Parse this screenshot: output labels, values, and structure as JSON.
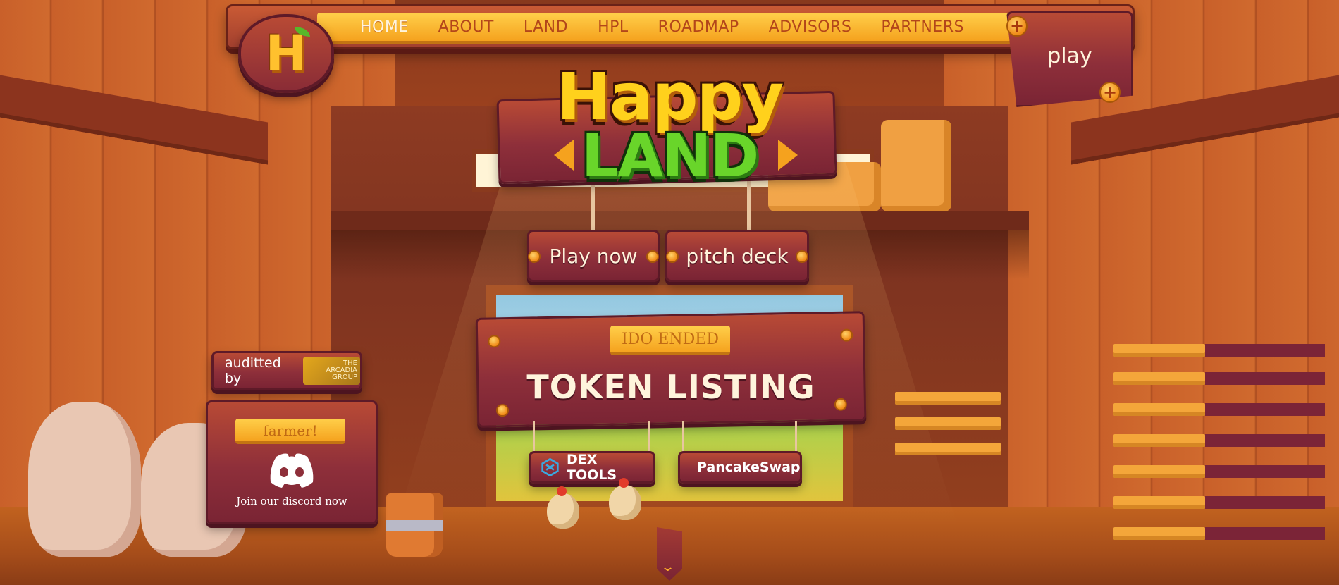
{
  "nav": {
    "items": [
      {
        "label": "HOME",
        "active": true
      },
      {
        "label": "ABOUT",
        "active": false
      },
      {
        "label": "LAND",
        "active": false
      },
      {
        "label": "HPL",
        "active": false
      },
      {
        "label": "ROADMAP",
        "active": false
      },
      {
        "label": "ADVISORS",
        "active": false
      },
      {
        "label": "PARTNERS",
        "active": false
      }
    ],
    "logo_letter": "H",
    "play_label": "play",
    "plus_icon": "+"
  },
  "hero": {
    "title_top": "Happy",
    "title_bottom": "LAND",
    "play_now_label": "Play now",
    "pitch_deck_label": "pitch deck"
  },
  "token": {
    "status_tag": "IDO ENDED",
    "headline": "TOKEN LISTING",
    "dextools_label": "DEX TOOLS",
    "pancakeswap_label": "PancakeSwap"
  },
  "audit": {
    "label": "auditted by",
    "auditor_logo_text": [
      "THE",
      "ARCADIA",
      "GROUP"
    ]
  },
  "discord": {
    "tag": "farmer!",
    "cta": "Join our discord now"
  },
  "scroll": {
    "chevron": "⌄"
  },
  "colors": {
    "accent_yellow": "#ffcf4a",
    "wood_dark": "#8e2f3a",
    "logo_green": "#69d52a",
    "logo_yellow": "#ffd11c",
    "text_light": "#fff4dc",
    "nav_text": "#b3461a"
  },
  "icons": {
    "logo": "happy-land-h-logo",
    "discord": "discord-icon",
    "dextools": "dextools-icon",
    "pancakeswap": "pancakeswap-bunny-icon",
    "scroll": "chevron-down-icon"
  }
}
